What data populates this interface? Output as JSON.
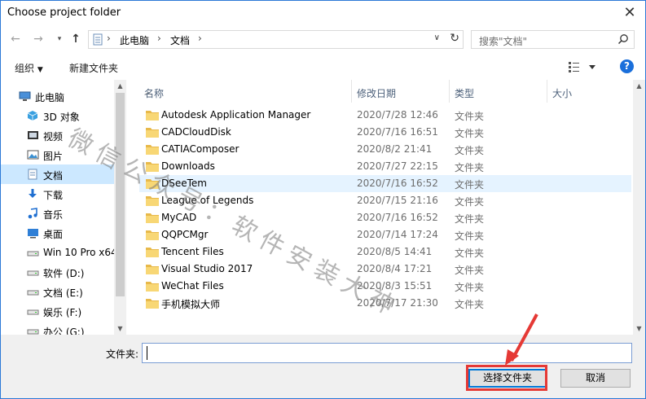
{
  "window": {
    "title": "Choose project folder"
  },
  "address": {
    "crumbs": [
      "此电脑",
      "文档"
    ],
    "search_placeholder": "搜索\"文档\""
  },
  "toolbar": {
    "organize": "组织",
    "new_folder": "新建文件夹",
    "help": "?"
  },
  "nav": {
    "items": [
      {
        "label": "此电脑",
        "icon": "computer-icon"
      },
      {
        "label": "3D 对象",
        "icon": "3d-objects-icon"
      },
      {
        "label": "视频",
        "icon": "video-icon"
      },
      {
        "label": "图片",
        "icon": "pictures-icon"
      },
      {
        "label": "文档",
        "icon": "documents-icon",
        "selected": true
      },
      {
        "label": "下载",
        "icon": "download-icon"
      },
      {
        "label": "音乐",
        "icon": "music-icon"
      },
      {
        "label": "桌面",
        "icon": "desktop-icon"
      },
      {
        "label": "Win 10 Pro x64",
        "icon": "drive-icon"
      },
      {
        "label": "软件 (D:)",
        "icon": "drive-icon"
      },
      {
        "label": "文档 (E:)",
        "icon": "drive-icon"
      },
      {
        "label": "娱乐 (F:)",
        "icon": "drive-icon"
      },
      {
        "label": "办公 (G:)",
        "icon": "drive-icon"
      }
    ]
  },
  "files": {
    "columns": [
      "名称",
      "修改日期",
      "类型",
      "大小"
    ],
    "rows": [
      {
        "name": "Autodesk Application Manager",
        "date": "2020/7/28 12:46",
        "type": "文件夹"
      },
      {
        "name": "CADCloudDisk",
        "date": "2020/7/16 16:51",
        "type": "文件夹"
      },
      {
        "name": "CATIAComposer",
        "date": "2020/8/2 21:41",
        "type": "文件夹"
      },
      {
        "name": "Downloads",
        "date": "2020/7/27 22:15",
        "type": "文件夹"
      },
      {
        "name": "DSeeTem",
        "date": "2020/7/16 16:52",
        "type": "文件夹",
        "hover": true
      },
      {
        "name": "League of Legends",
        "date": "2020/7/15 21:16",
        "type": "文件夹"
      },
      {
        "name": "MyCAD",
        "date": "2020/7/16 16:52",
        "type": "文件夹"
      },
      {
        "name": "QQPCMgr",
        "date": "2020/7/14 17:24",
        "type": "文件夹"
      },
      {
        "name": "Tencent Files",
        "date": "2020/8/5 14:41",
        "type": "文件夹"
      },
      {
        "name": "Visual Studio 2017",
        "date": "2020/8/4 17:21",
        "type": "文件夹"
      },
      {
        "name": "WeChat Files",
        "date": "2020/8/3 15:51",
        "type": "文件夹"
      },
      {
        "name": "手机模拟大师",
        "date": "2020/7/17 21:30",
        "type": "文件夹"
      }
    ]
  },
  "bottom": {
    "folder_label": "文件夹:",
    "folder_value": "",
    "select_button": "选择文件夹",
    "cancel_button": "取消"
  },
  "watermark": {
    "text": "微信公众号：软件安装大神"
  },
  "colors": {
    "accent": "#0078d7",
    "selected": "#cce8ff",
    "hover": "#e5f3ff",
    "highlight": "#e53935",
    "folder": "#f8d775"
  }
}
